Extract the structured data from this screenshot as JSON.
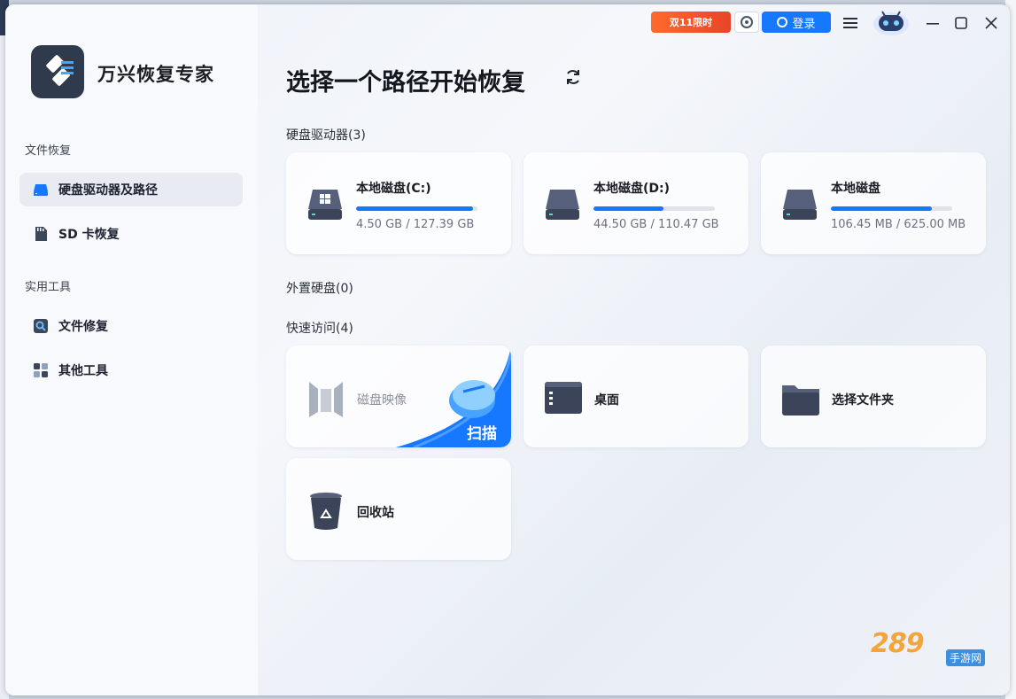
{
  "app": {
    "name": "万兴恢复专家"
  },
  "topbar": {
    "promo_label": "双11限时",
    "login_label": "登录"
  },
  "sidebar": {
    "section_file_recovery": "文件恢复",
    "items_recovery": [
      {
        "label": "硬盘驱动器及路径",
        "active": true
      },
      {
        "label": "SD 卡恢复",
        "active": false
      }
    ],
    "section_tools": "实用工具",
    "items_tools": [
      {
        "label": "文件修复"
      },
      {
        "label": "其他工具"
      }
    ]
  },
  "main": {
    "title": "选择一个路径开始恢复",
    "drives_label": "硬盘驱动器(3)",
    "drives": [
      {
        "name": "本地磁盘(C:)",
        "size": "4.50 GB / 127.39 GB",
        "usage": 0.96
      },
      {
        "name": "本地磁盘(D:)",
        "size": "44.50 GB / 110.47 GB",
        "usage": 0.58
      },
      {
        "name": "本地磁盘",
        "size": "106.45 MB / 625.00 MB",
        "usage": 0.83
      }
    ],
    "external_label": "外置硬盘(0)",
    "quick_label": "快速访问(4)",
    "quick": [
      {
        "label": "磁盘映像",
        "action": "扫描"
      },
      {
        "label": "桌面"
      },
      {
        "label": "选择文件夹"
      },
      {
        "label": "回收站"
      }
    ]
  },
  "watermark": {
    "main": "289",
    "sub": "手游网"
  },
  "colors": {
    "accent": "#1677ff",
    "sidebar_bg": "#f7f9fc",
    "logo_bg": "#2f3a4d"
  }
}
